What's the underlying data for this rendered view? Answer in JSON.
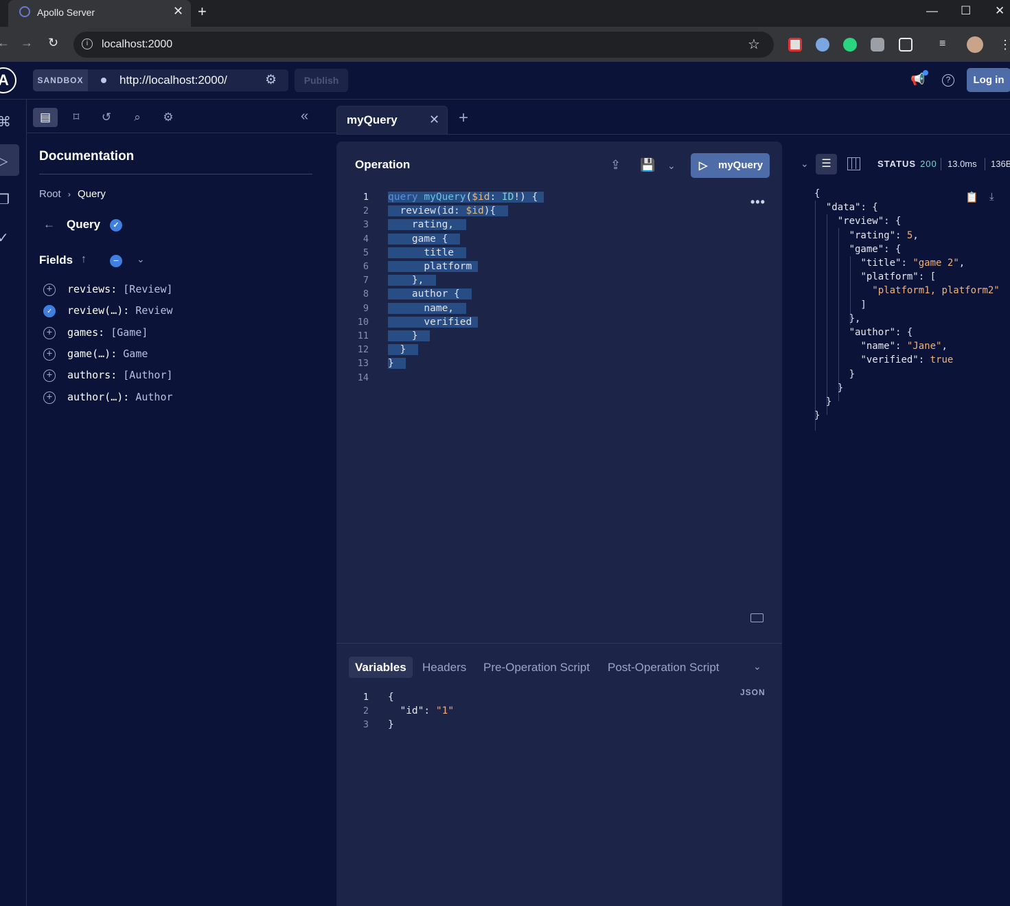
{
  "browser": {
    "tab_title": "Apollo Server",
    "url": "localhost:2000"
  },
  "header": {
    "sandbox_label": "SANDBOX",
    "endpoint_url": "http://localhost:2000/",
    "publish_label": "Publish",
    "login_label": "Log in"
  },
  "docs": {
    "title": "Documentation",
    "breadcrumb_root": "Root",
    "breadcrumb_sep": "›",
    "breadcrumb_current": "Query",
    "type_title": "Query",
    "fields_label": "Fields",
    "fields": [
      {
        "name": "reviews:",
        "type": "[Review]",
        "selected": false
      },
      {
        "name": "review(…):",
        "type": "Review",
        "selected": true
      },
      {
        "name": "games:",
        "type": "[Game]",
        "selected": false
      },
      {
        "name": "game(…):",
        "type": "Game",
        "selected": false
      },
      {
        "name": "authors:",
        "type": "[Author]",
        "selected": false
      },
      {
        "name": "author(…):",
        "type": "Author",
        "selected": false
      }
    ]
  },
  "operation": {
    "tab_label": "myQuery",
    "title": "Operation",
    "run_label": "myQuery",
    "line_numbers": [
      "1",
      "2",
      "3",
      "4",
      "5",
      "6",
      "7",
      "8",
      "9",
      "10",
      "11",
      "12",
      "13",
      "14"
    ]
  },
  "variables": {
    "tabs": [
      "Variables",
      "Headers",
      "Pre-Operation Script",
      "Post-Operation Script"
    ],
    "format_label": "JSON",
    "line_numbers": [
      "1",
      "2",
      "3"
    ],
    "id_key": "\"id\"",
    "id_value": "\"1\""
  },
  "response": {
    "status_label": "STATUS",
    "status_code": "200",
    "time": "13.0ms",
    "size": "136B",
    "rating": "5",
    "title": "\"game 2\"",
    "platform_value": "\"platform1, platform2\"",
    "name": "\"Jane\"",
    "verified": "true"
  }
}
